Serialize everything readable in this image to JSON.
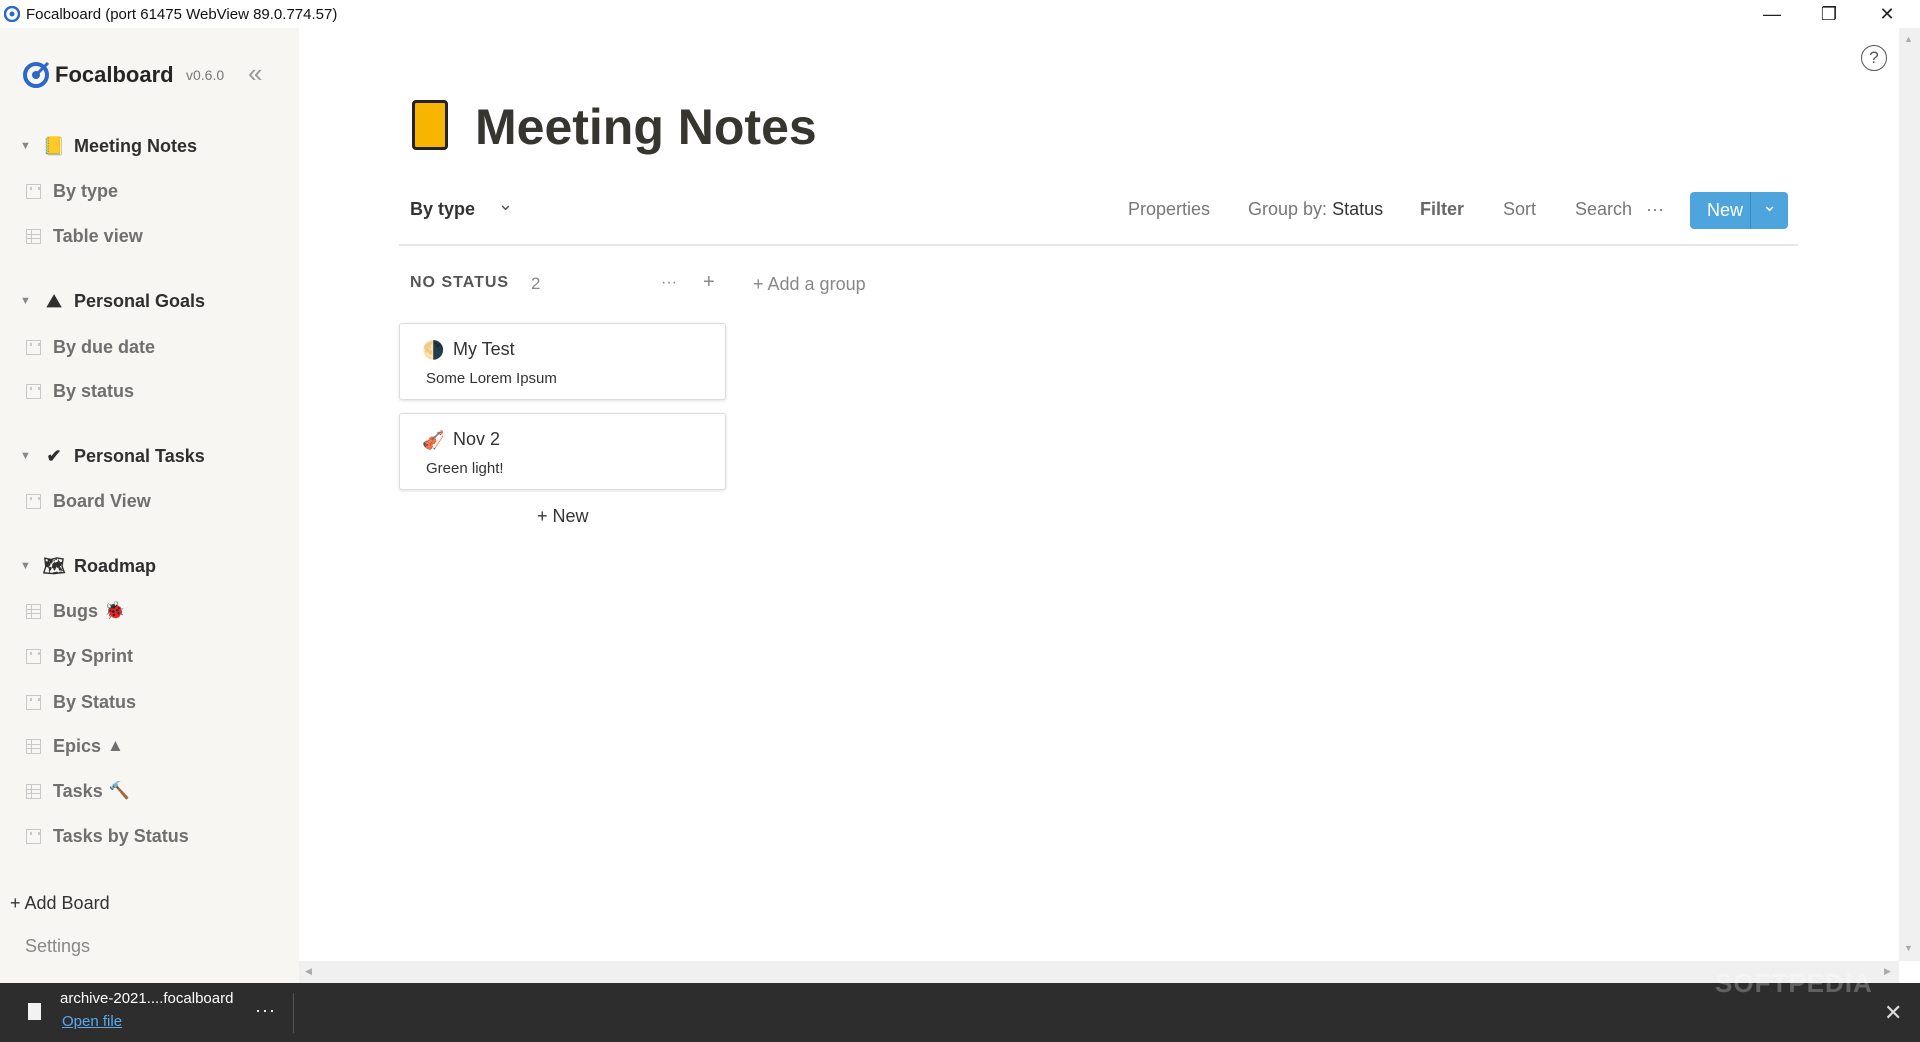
{
  "window": {
    "title": "Focalboard (port 61475 WebView 89.0.774.57)",
    "minimize": "—",
    "restore": "❐",
    "close": "✕"
  },
  "sidebar": {
    "logo": "Focalboard",
    "version": "v0.6.0",
    "collapse": "«",
    "boards": [
      {
        "label": "Meeting Notes",
        "icon": "notepad-icon",
        "emoji": "📒",
        "views": [
          {
            "label": "By type",
            "type": "board"
          },
          {
            "label": "Table view",
            "type": "table"
          }
        ]
      },
      {
        "label": "Personal Goals",
        "icon": "mountain-icon",
        "emoji": "⛰",
        "views": [
          {
            "label": "By due date",
            "type": "board"
          },
          {
            "label": "By status",
            "type": "board"
          }
        ]
      },
      {
        "label": "Personal Tasks",
        "icon": "check-icon",
        "emoji": "✔",
        "views": [
          {
            "label": "Board View",
            "type": "board"
          }
        ]
      },
      {
        "label": "Roadmap",
        "icon": "map-icon",
        "emoji": "🗺",
        "views": [
          {
            "label": "Bugs",
            "type": "table",
            "suffix": "🐞"
          },
          {
            "label": "By Sprint",
            "type": "board"
          },
          {
            "label": "By Status",
            "type": "board"
          },
          {
            "label": "Epics",
            "type": "table",
            "suffix": "▲"
          },
          {
            "label": "Tasks",
            "type": "table",
            "suffix": "🔨"
          },
          {
            "label": "Tasks by Status",
            "type": "board"
          }
        ]
      }
    ],
    "add_board": "+ Add Board",
    "settings": "Settings"
  },
  "main": {
    "title": "Meeting Notes",
    "view_name": "By type",
    "toolbar": {
      "properties": "Properties",
      "group_by_label": "Group by:",
      "group_by_value": "Status",
      "filter": "Filter",
      "sort": "Sort",
      "search": "Search",
      "more": "···",
      "new": "New",
      "new_chevron": "⌄"
    },
    "group": {
      "name": "NO STATUS",
      "count": "2",
      "more": "···",
      "add": "+",
      "add_group": "+ Add a group"
    },
    "cards": [
      {
        "title": "My Test",
        "desc": "Some Lorem Ipsum",
        "emoji": "🌗"
      },
      {
        "title": "Nov 2",
        "desc": "Green light!",
        "emoji": "🎻"
      }
    ],
    "add_card": "+ New",
    "help": "?"
  },
  "download": {
    "filename": "archive-2021....focalboard",
    "open": "Open file",
    "more": "···",
    "close": "✕"
  },
  "watermark": "SOFTPEDIA",
  "colors": {
    "accent": "#4ea4dc",
    "sidebar_bg": "#f7f6f3",
    "download_bg": "#2d2d2d"
  }
}
